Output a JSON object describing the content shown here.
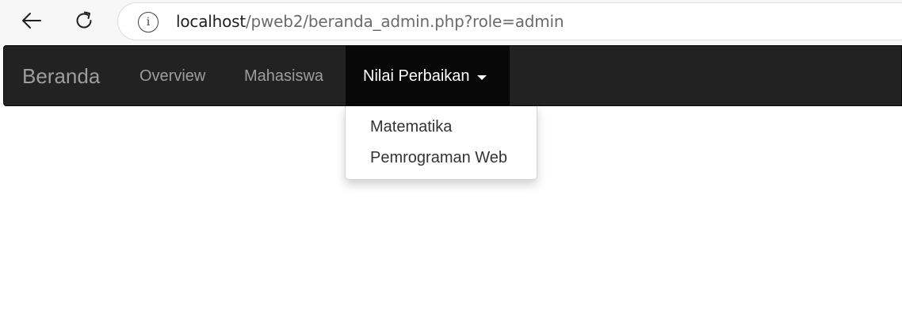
{
  "browser": {
    "url_host": "localhost",
    "url_path": "/pweb2/beranda_admin.php?role=admin",
    "back_icon": "arrow-left-icon",
    "reload_icon": "reload-icon",
    "info_icon": "info-icon",
    "info_glyph": "i"
  },
  "navbar": {
    "brand": "Beranda",
    "links": [
      "Overview",
      "Mahasiswa"
    ],
    "dropdown": {
      "label": "Nilai Perbaikan",
      "items": [
        "Matematika",
        "Pemrograman Web"
      ]
    },
    "colors": {
      "background": "#222222",
      "active_background": "#080808",
      "link": "#9d9d9d",
      "active_link": "#ffffff"
    }
  }
}
